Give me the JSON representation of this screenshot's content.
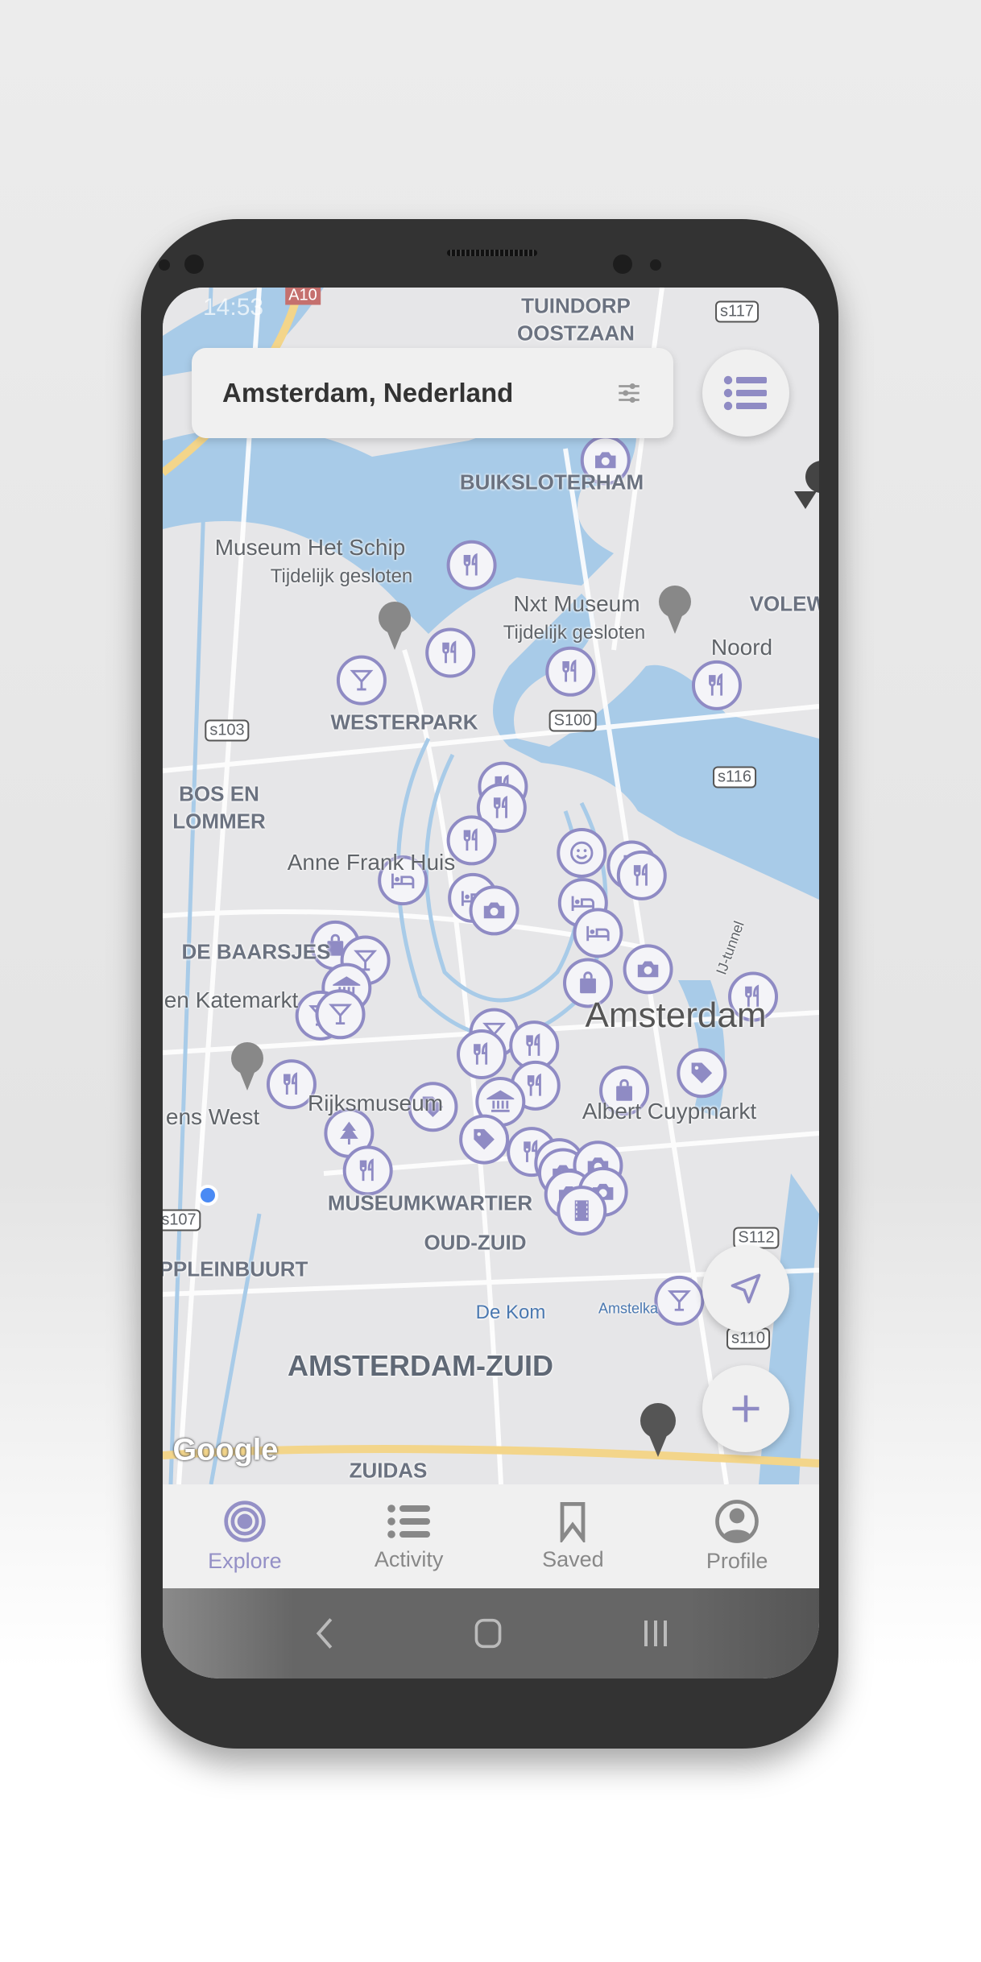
{
  "status_bar": {
    "time": "14:53"
  },
  "search": {
    "location": "Amsterdam, Nederland",
    "filter_icon": "sliders-icon"
  },
  "list_button": {
    "icon": "list-icon"
  },
  "map": {
    "labels": {
      "tuindorp": "TUINDORP",
      "oostzaan": "OOSTZAAN",
      "buiksloterham": "BUIKSLOTERHAM",
      "museum_het_schip": "Museum Het Schip",
      "closed1": "Tijdelijk gesloten",
      "nxt_museum": "Nxt Museum",
      "closed2": "Tijdelijk gesloten",
      "volewijck": "VOLEWI",
      "noord": "Noord",
      "westerpark": "WESTERPARK",
      "bos_en": "BOS EN",
      "lommer": "LOMMER",
      "anne_frank": "Anne Frank Huis",
      "de_baarsjes": "DE BAARSJES",
      "katemarkt": "en Katemarkt",
      "amsterdam": "Amsterdam",
      "rijksmuseum": "Rijksmuseum",
      "albert_cuyp": "Albert Cuypmarkt",
      "west": "ens West",
      "museumkwartier": "MUSEUMKWARTIER",
      "oud_zuid": "OUD-ZUID",
      "pleinbuurt": "PPLEINBUURT",
      "de_kom": "De Kom",
      "amsterdam_zuid": "AMSTERDAM-ZUID",
      "zuidas": "ZUIDAS",
      "s103": "s103",
      "s100": "S100",
      "s116": "s116",
      "s117": "s117",
      "s107": "s107",
      "s112": "S112",
      "s110": "s110",
      "a10": "A10",
      "ij_tunnel": "IJ-tunnel",
      "amstelkanaal": "Amstelka",
      "google": "Google"
    },
    "marker_color": "#8f8bc4"
  },
  "controls": {
    "locate_icon": "navigation-arrow-icon",
    "zoom_in_icon": "plus-icon"
  },
  "bottom_nav": [
    {
      "label": "Explore",
      "icon": "target-icon",
      "active": true
    },
    {
      "label": "Activity",
      "icon": "list-icon",
      "active": false
    },
    {
      "label": "Saved",
      "icon": "bookmark-icon",
      "active": false
    },
    {
      "label": "Profile",
      "icon": "profile-icon",
      "active": false
    }
  ],
  "system_nav": {
    "back": "back-icon",
    "home": "home-icon",
    "recents": "recents-icon"
  },
  "colors": {
    "accent": "#9490c6",
    "text": "#333333",
    "nav_inactive": "#888888"
  }
}
